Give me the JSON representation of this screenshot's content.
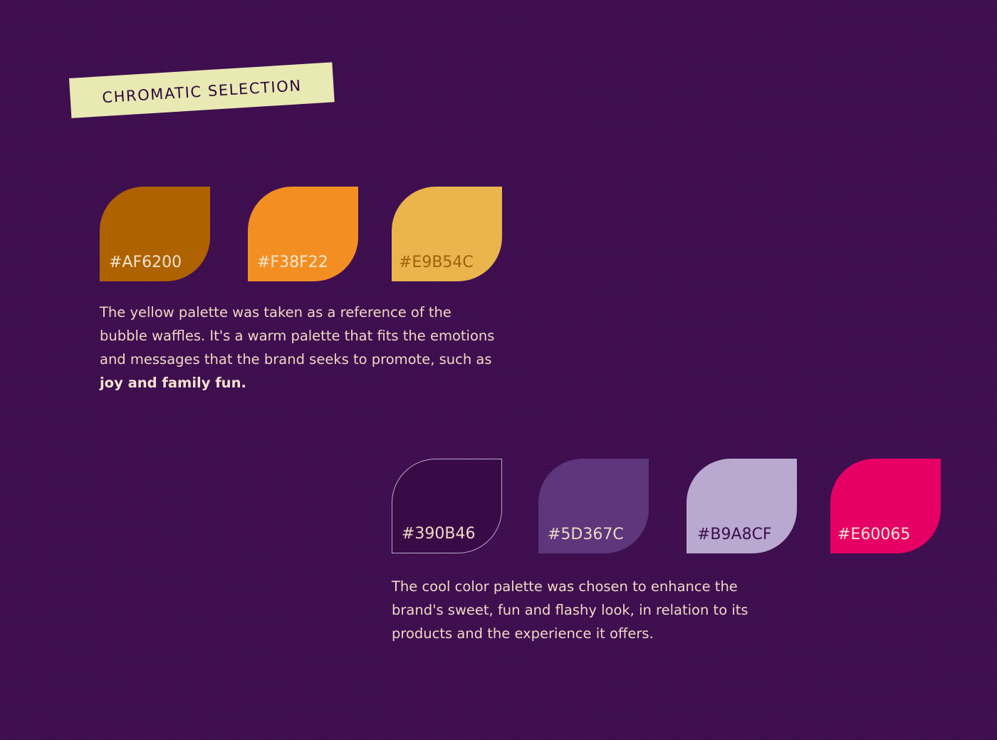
{
  "section_tag": "CHROMATIC SELECTION",
  "warm_palette": {
    "swatches": [
      {
        "hex": "#AF6200",
        "fill": "#AF6200",
        "text_color": "#f3e4d0"
      },
      {
        "hex": "#F38F22",
        "fill": "#F38F22",
        "text_color": "#f7e6cf"
      },
      {
        "hex": "#E9B54C",
        "fill": "#E9B54C",
        "text_color": "#a1600b"
      }
    ],
    "description": "The yellow palette was taken as a reference of the bubble waffles. It's a warm palette that fits the emotions and messages that the brand seeks to promote, such as",
    "description_emphasis": "joy and family fun."
  },
  "cool_palette": {
    "swatches": [
      {
        "hex": "#390B46",
        "fill": "#390B46",
        "text_color": "#efd9c4",
        "outline": "#b9a8cf"
      },
      {
        "hex": "#5D367C",
        "fill": "#5D367C",
        "text_color": "#efd9c4"
      },
      {
        "hex": "#B9A8CF",
        "fill": "#B9A8CF",
        "text_color": "#3d0c4e"
      },
      {
        "hex": "#E60065",
        "fill": "#E60065",
        "text_color": "#f3e4d0"
      }
    ],
    "description": "The cool color palette was chosen to enhance the brand's sweet, fun and flashy look, in relation to its products and the experience it offers."
  },
  "colors": {
    "background": "#3d0c4e",
    "tag_background": "#e9e9b4",
    "body_text": "#efd9c4"
  }
}
